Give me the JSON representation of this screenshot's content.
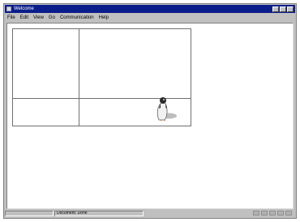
{
  "window": {
    "title": "Welcome",
    "controls": [
      "minimize",
      "maximize",
      "close"
    ]
  },
  "menu": {
    "items": [
      "File",
      "Edit",
      "View",
      "Go",
      "Communication",
      "Help"
    ]
  },
  "status": {
    "left_text": "",
    "center_text": "Document: Done"
  },
  "icons": {
    "app": "app-icon",
    "character": "penguin-icon",
    "status": [
      "security-icon",
      "mail-icon",
      "composer-icon",
      "address-icon",
      "network-icon"
    ]
  },
  "colors": {
    "titlebar": "#0a1d8a",
    "chrome": "#c0c0c0",
    "canvas": "#ffffff",
    "grid_line": "#707070"
  }
}
